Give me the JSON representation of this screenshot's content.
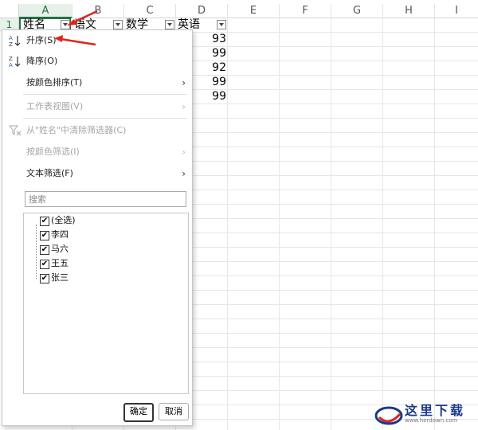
{
  "columns": [
    "A",
    "B",
    "C",
    "D",
    "E",
    "F",
    "G",
    "H",
    "I"
  ],
  "row_number": "1",
  "headers": [
    "姓名",
    "语文",
    "数学",
    "英语"
  ],
  "english_scores": [
    "93",
    "99",
    "92",
    "99",
    "99"
  ],
  "menu": {
    "sort_asc": "升序(S)",
    "sort_desc": "降序(O)",
    "sort_by_color": "按颜色排序(T)",
    "sheet_view": "工作表视图(V)",
    "clear_filter": "从\"姓名\"中清除筛选器(C)",
    "filter_by_color": "按颜色筛选(I)",
    "text_filter": "文本筛选(F)",
    "search_placeholder": "搜索",
    "items": [
      "(全选)",
      "李四",
      "马六",
      "王五",
      "张三"
    ],
    "ok": "确定",
    "cancel": "取消"
  },
  "watermark": {
    "text": "这里下载",
    "url": "www.herdown.com"
  },
  "colors": {
    "excel_green": "#217346",
    "arrow_red": "#e2231a"
  }
}
